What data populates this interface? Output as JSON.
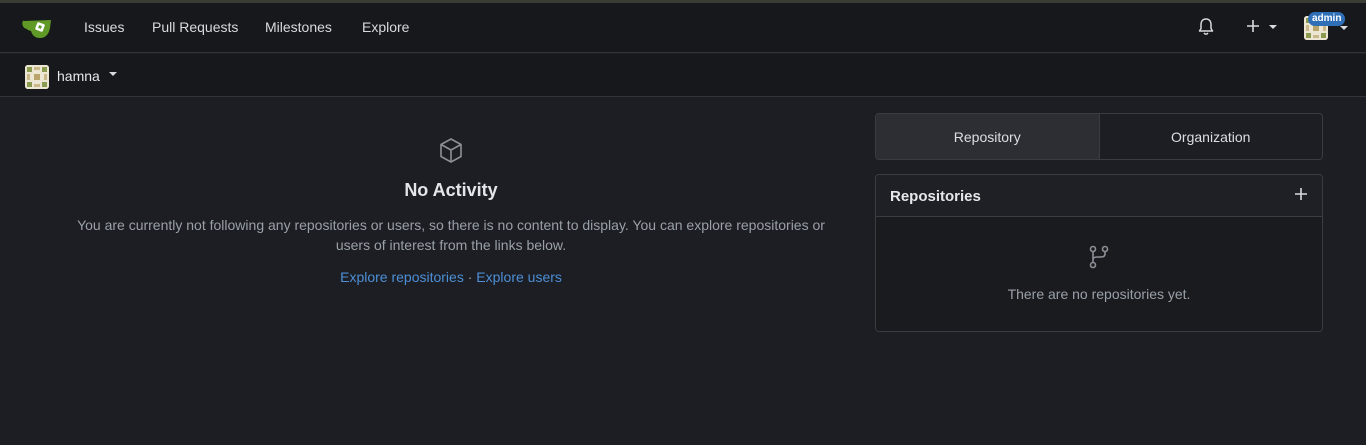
{
  "nav": {
    "items": [
      "Issues",
      "Pull Requests",
      "Milestones",
      "Explore"
    ],
    "admin_badge": "admin"
  },
  "context": {
    "user_name": "hamna"
  },
  "activity": {
    "heading": "No Activity",
    "message": "You are currently not following any repositories or users, so there is no content to display. You can explore repositories or users of interest from the links below.",
    "explore_repos_link": "Explore repositories",
    "separator": "·",
    "explore_users_link": "Explore users"
  },
  "switcher": {
    "tabs": [
      "Repository",
      "Organization"
    ],
    "active": "Repository"
  },
  "repositories": {
    "title": "Repositories",
    "empty_text": "There are no repositories yet."
  },
  "colors": {
    "background": "#1c1e23",
    "navbar": "#17181c",
    "link": "#4d8fd6",
    "logo_green": "#609926",
    "badge": "#2f6fb8"
  }
}
